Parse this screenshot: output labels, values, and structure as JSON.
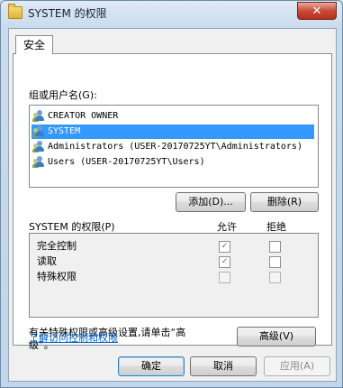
{
  "window": {
    "title": "SYSTEM 的权限",
    "close_label": "✕"
  },
  "tab": {
    "label": "安全"
  },
  "groups_label": "组或用户名(G):",
  "users": [
    {
      "name": "CREATOR OWNER",
      "selected": false
    },
    {
      "name": "SYSTEM",
      "selected": true
    },
    {
      "name": "Administrators (USER-20170725YT\\Administrators)",
      "selected": false
    },
    {
      "name": "Users (USER-20170725YT\\Users)",
      "selected": false
    }
  ],
  "buttons": {
    "add": "添加(D)...",
    "remove": "删除(R)"
  },
  "permissions": {
    "header": "SYSTEM 的权限(P)",
    "allow_col": "允许",
    "deny_col": "拒绝",
    "rows": [
      {
        "name": "完全控制",
        "allow": true,
        "deny": false,
        "enabled": true
      },
      {
        "name": "读取",
        "allow": true,
        "deny": false,
        "enabled": true
      },
      {
        "name": "特殊权限",
        "allow": false,
        "deny": false,
        "enabled": false
      }
    ]
  },
  "advanced": {
    "text_line1": "有关特殊权限或高级设置,请单击“高",
    "text_line2": "级”。",
    "button": "高级(V)"
  },
  "link": "了解访问控制和权限",
  "footer": {
    "ok": "确定",
    "cancel": "取消",
    "apply": "应用(A)"
  }
}
